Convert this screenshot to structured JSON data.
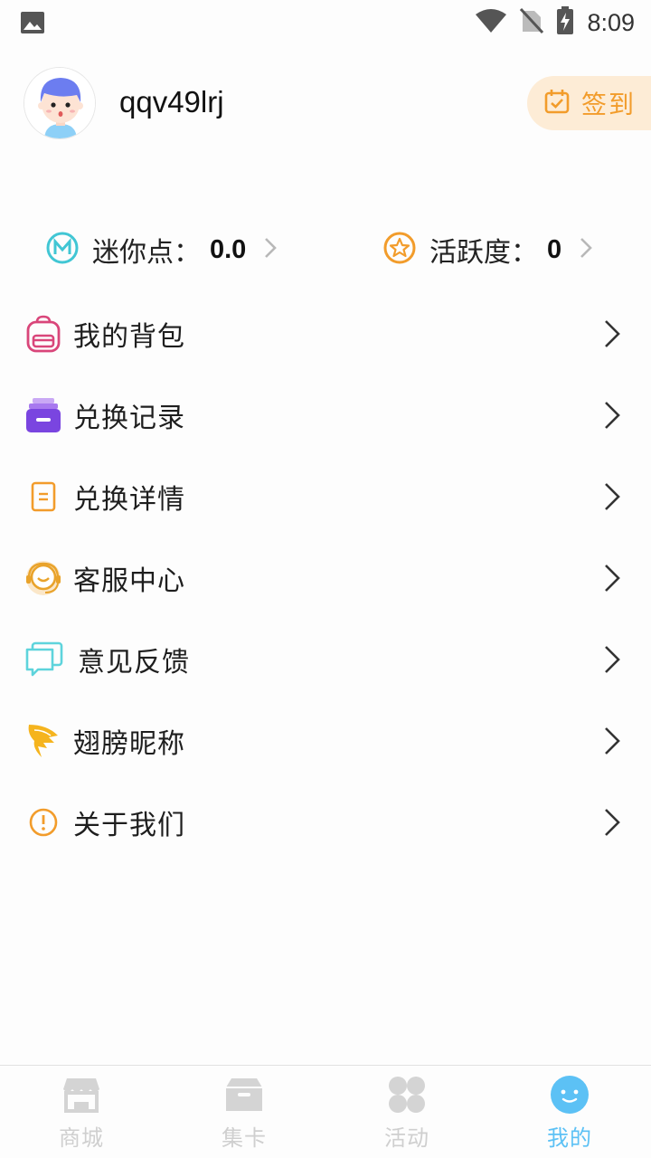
{
  "status_bar": {
    "time": "8:09"
  },
  "profile": {
    "username": "qqv49lrj",
    "signin_label": "签到"
  },
  "stats": {
    "mini_points": {
      "label": "迷你点：",
      "value": "0.0"
    },
    "activity": {
      "label": "活跃度：",
      "value": "0"
    }
  },
  "menu": [
    {
      "label": "我的背包",
      "icon": "backpack-icon"
    },
    {
      "label": "兑换记录",
      "icon": "exchange-record-icon"
    },
    {
      "label": "兑换详情",
      "icon": "document-icon"
    },
    {
      "label": "客服中心",
      "icon": "headset-icon"
    },
    {
      "label": "意见反馈",
      "icon": "chat-icon"
    },
    {
      "label": "翅膀昵称",
      "icon": "wing-icon"
    },
    {
      "label": "关于我们",
      "icon": "info-icon"
    }
  ],
  "bottom_nav": [
    {
      "label": "商城",
      "icon": "store-icon",
      "active": false
    },
    {
      "label": "集卡",
      "icon": "card-box-icon",
      "active": false
    },
    {
      "label": "活动",
      "icon": "clover-icon",
      "active": false
    },
    {
      "label": "我的",
      "icon": "smiley-icon",
      "active": true
    }
  ],
  "colors": {
    "accent_blue": "#5cc1f5",
    "signin_bg": "#fdecd6",
    "signin_text": "#f29c2b",
    "nav_inactive": "#cfcfcf"
  }
}
